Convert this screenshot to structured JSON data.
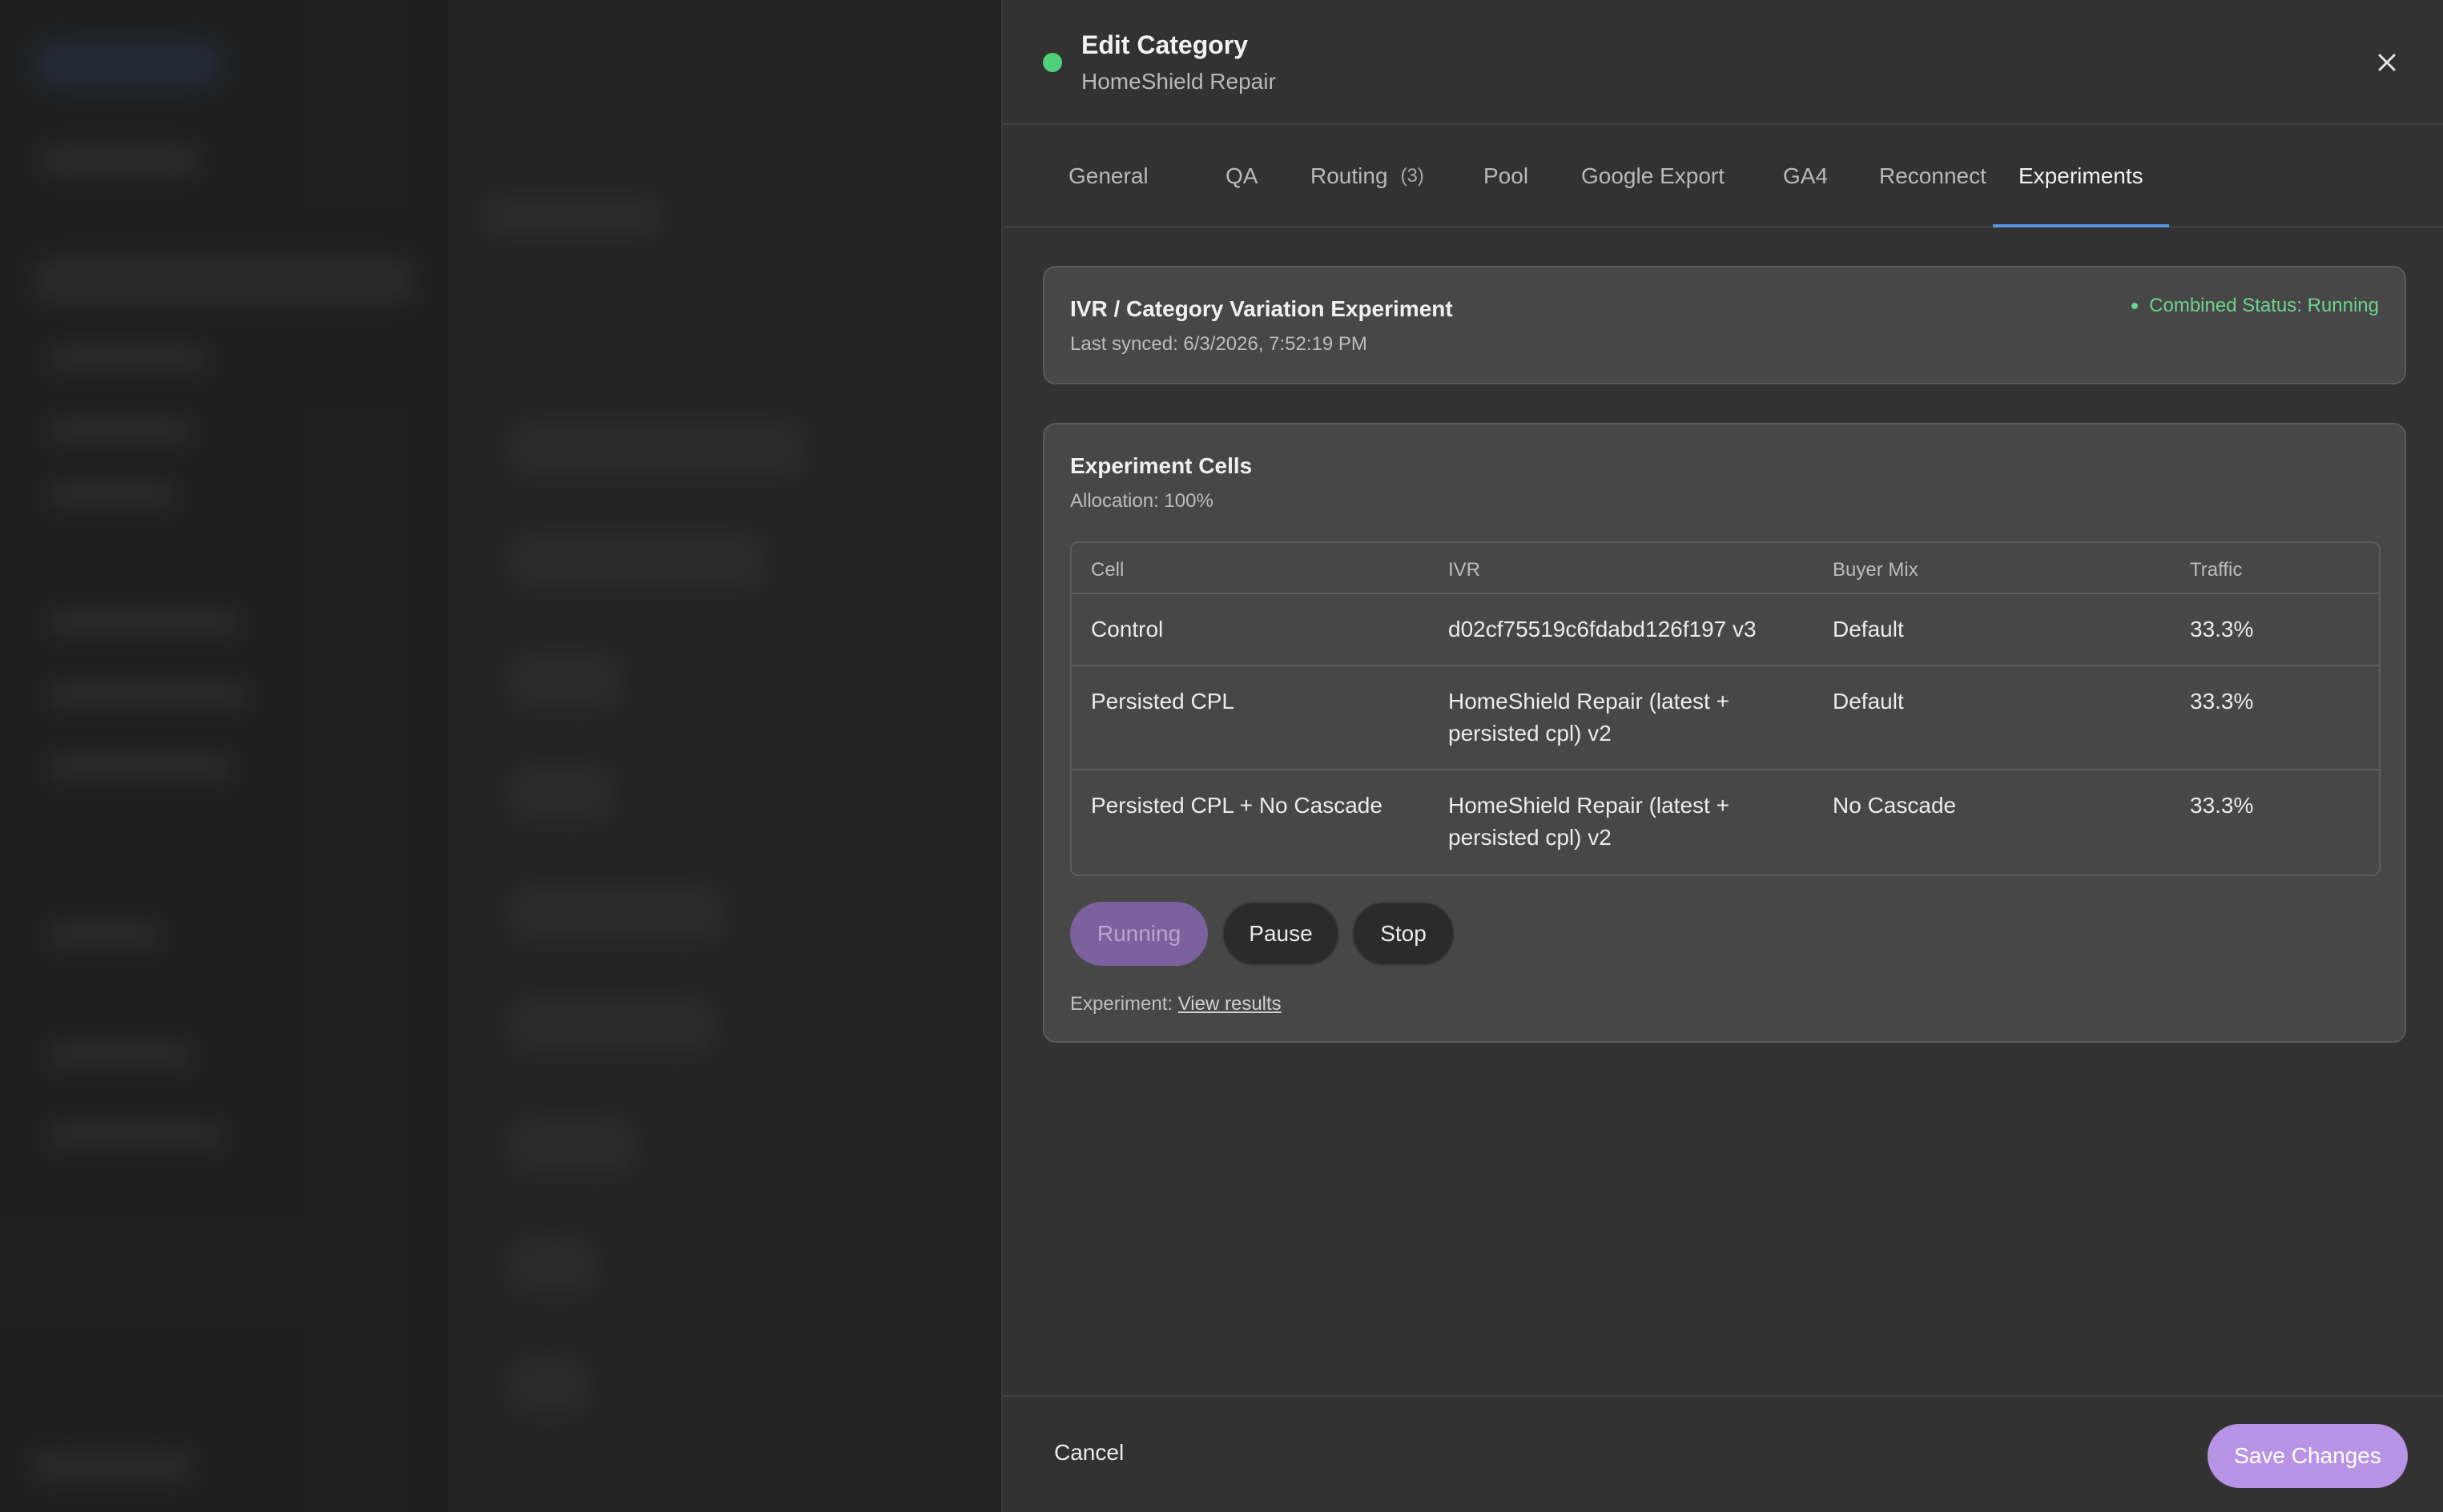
{
  "header": {
    "title": "Edit Category",
    "subtitle": "HomeShield Repair",
    "status_color": "#4ed17a",
    "close_icon": "close-icon"
  },
  "tabs": [
    {
      "label": "General",
      "count": ""
    },
    {
      "label": "QA",
      "count": ""
    },
    {
      "label": "Routing",
      "count": "(3)"
    },
    {
      "label": "Pool",
      "count": ""
    },
    {
      "label": "Google Export",
      "count": ""
    },
    {
      "label": "GA4",
      "count": ""
    },
    {
      "label": "Reconnect",
      "count": ""
    },
    {
      "label": "Experiments",
      "count": ""
    }
  ],
  "active_tab": "Experiments",
  "experiment": {
    "title": "IVR / Category Variation Experiment",
    "last_synced": "Last synced: 6/3/2026, 7:52:19 PM",
    "combined_status": "Combined Status: Running"
  },
  "cells": {
    "title": "Experiment Cells",
    "allocation": "Allocation: 100%",
    "columns": [
      "Cell",
      "IVR",
      "Buyer Mix",
      "Traffic"
    ],
    "rows": [
      {
        "cell": "Control",
        "ivr": "d02cf75519c6fdabd126f197 v3",
        "buyer_mix": "Default",
        "traffic": "33.3%"
      },
      {
        "cell": "Persisted CPL",
        "ivr": "HomeShield Repair (latest + persisted cpl) v2",
        "buyer_mix": "Default",
        "traffic": "33.3%"
      },
      {
        "cell": "Persisted CPL + No Cascade",
        "ivr": "HomeShield Repair (latest + persisted cpl) v2",
        "buyer_mix": "No Cascade",
        "traffic": "33.3%"
      }
    ],
    "buttons": {
      "running": "Running",
      "pause": "Pause",
      "stop": "Stop"
    },
    "experiment_label": "Experiment:",
    "view_results": "View results"
  },
  "footer": {
    "cancel": "Cancel",
    "save": "Save Changes"
  }
}
